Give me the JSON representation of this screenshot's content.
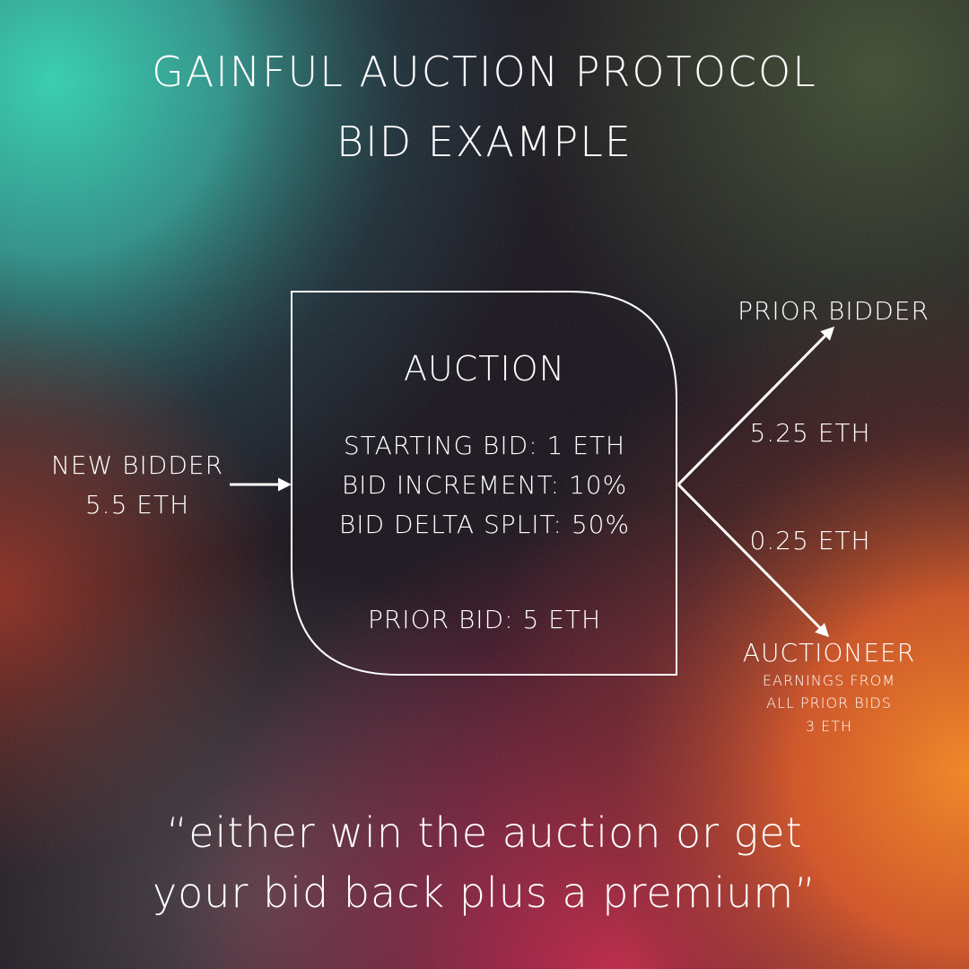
{
  "title": {
    "line1": "GAINFUL AUCTION PROTOCOL",
    "line2": "BID EXAMPLE"
  },
  "new_bidder": {
    "label": "NEW BIDDER",
    "amount": "5.5 ETH"
  },
  "auction_box": {
    "heading": "AUCTION",
    "starting_bid": "STARTING BID: 1 ETH",
    "bid_increment": "BID INCREMENT: 10%",
    "bid_delta_split": "BID DELTA SPLIT: 50%",
    "prior_bid": "PRIOR BID: 5 ETH"
  },
  "prior_bidder": {
    "label": "PRIOR BIDDER",
    "amount": "5.25 ETH"
  },
  "auctioneer": {
    "amount": "0.25 ETH",
    "label": "AUCTIONEER",
    "earnings_line1": "EARNINGS FROM",
    "earnings_line2": "ALL PRIOR BIDS",
    "earnings_value": "3 ETH"
  },
  "quote": {
    "line1": "“either win the auction or get",
    "line2": "your bid back plus a premium”"
  },
  "colors": {
    "teal": "#2fbfa6",
    "orange": "#f07a1c",
    "magenta": "#d8204a",
    "dark": "#120e16",
    "line": "#ffffff"
  },
  "icons": [
    "arrow-right-icon",
    "arrow-up-right-icon",
    "arrow-down-right-icon"
  ]
}
